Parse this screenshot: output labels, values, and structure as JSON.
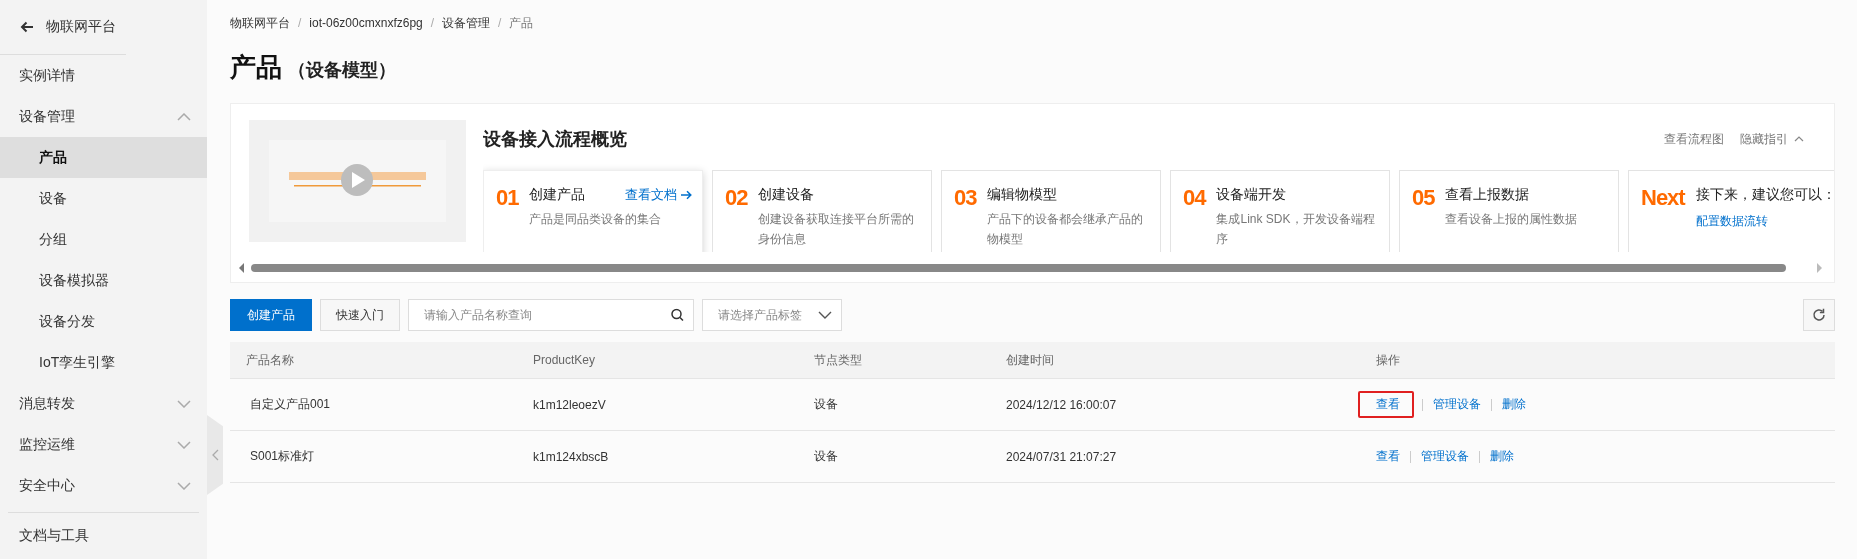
{
  "sidebar": {
    "back_label": "物联网平台",
    "items": [
      {
        "label": "实例详情",
        "kind": "link",
        "selected": false
      },
      {
        "label": "设备管理",
        "kind": "group",
        "expanded": true,
        "selected": false,
        "children": [
          {
            "label": "产品",
            "selected": true
          },
          {
            "label": "设备",
            "selected": false
          },
          {
            "label": "分组",
            "selected": false
          },
          {
            "label": "设备模拟器",
            "selected": false
          },
          {
            "label": "设备分发",
            "selected": false
          },
          {
            "label": "IoT孪生引擎",
            "selected": false
          }
        ]
      },
      {
        "label": "消息转发",
        "kind": "group",
        "expanded": false,
        "selected": false
      },
      {
        "label": "监控运维",
        "kind": "group",
        "expanded": false,
        "selected": false
      },
      {
        "label": "安全中心",
        "kind": "group",
        "expanded": false,
        "selected": false
      }
    ],
    "footer_items": [
      {
        "label": "文档与工具",
        "selected": false
      }
    ]
  },
  "breadcrumb": [
    "物联网平台",
    "iot-06z00cmxnxfz6pg",
    "设备管理",
    "产品"
  ],
  "breadcrumb_separator": "/",
  "page_title": "产品",
  "page_subtitle": "（设备模型）",
  "guide": {
    "title": "设备接入流程概览",
    "links": [
      "查看流程图",
      "隐藏指引"
    ],
    "expanded": true,
    "video": {
      "kind": "picture"
    },
    "steps": [
      {
        "number": "01",
        "title": "创建产品",
        "desc": "产品是同品类设备的集合",
        "link": "查看文档",
        "active": true
      },
      {
        "number": "02",
        "title": "创建设备",
        "desc": "创建设备获取连接平台所需的身份信息",
        "active": false
      },
      {
        "number": "03",
        "title": "编辑物模型",
        "desc": "产品下的设备都会继承产品的物模型",
        "active": false
      },
      {
        "number": "04",
        "title": "设备端开发",
        "desc": "集成Link SDK，开发设备端程序",
        "active": false
      },
      {
        "number": "05",
        "title": "查看上报数据",
        "desc": "查看设备上报的属性数据",
        "active": false
      },
      {
        "number": "Next",
        "title": "接下来，建议您可以：",
        "link": "配置数据流转",
        "active": false
      }
    ]
  },
  "toolbar": {
    "primary_button": "创建产品",
    "secondary_button": "快速入门",
    "search": {
      "placeholder": "请输入产品名称查询"
    },
    "tag_select": {
      "placeholder": "请选择产品标签"
    }
  },
  "table": {
    "columns": [
      "产品名称",
      "ProductKey",
      "节点类型",
      "创建时间",
      "操作"
    ],
    "rows": [
      {
        "cells": [
          "自定义产品001",
          "k1m12leoezV",
          "设备",
          "2024/12/12 16:00:07"
        ],
        "actions": [
          {
            "label": "查看",
            "highlighted": true
          },
          {
            "label": "管理设备",
            "highlighted": false
          },
          {
            "label": "删除",
            "highlighted": false
          }
        ]
      },
      {
        "cells": [
          "S001标准灯",
          "k1m124xbscB",
          "设备",
          "2024/07/31 21:07:27"
        ],
        "actions": [
          {
            "label": "查看",
            "highlighted": false
          },
          {
            "label": "管理设备",
            "highlighted": false
          },
          {
            "label": "删除",
            "highlighted": false
          }
        ]
      }
    ]
  }
}
